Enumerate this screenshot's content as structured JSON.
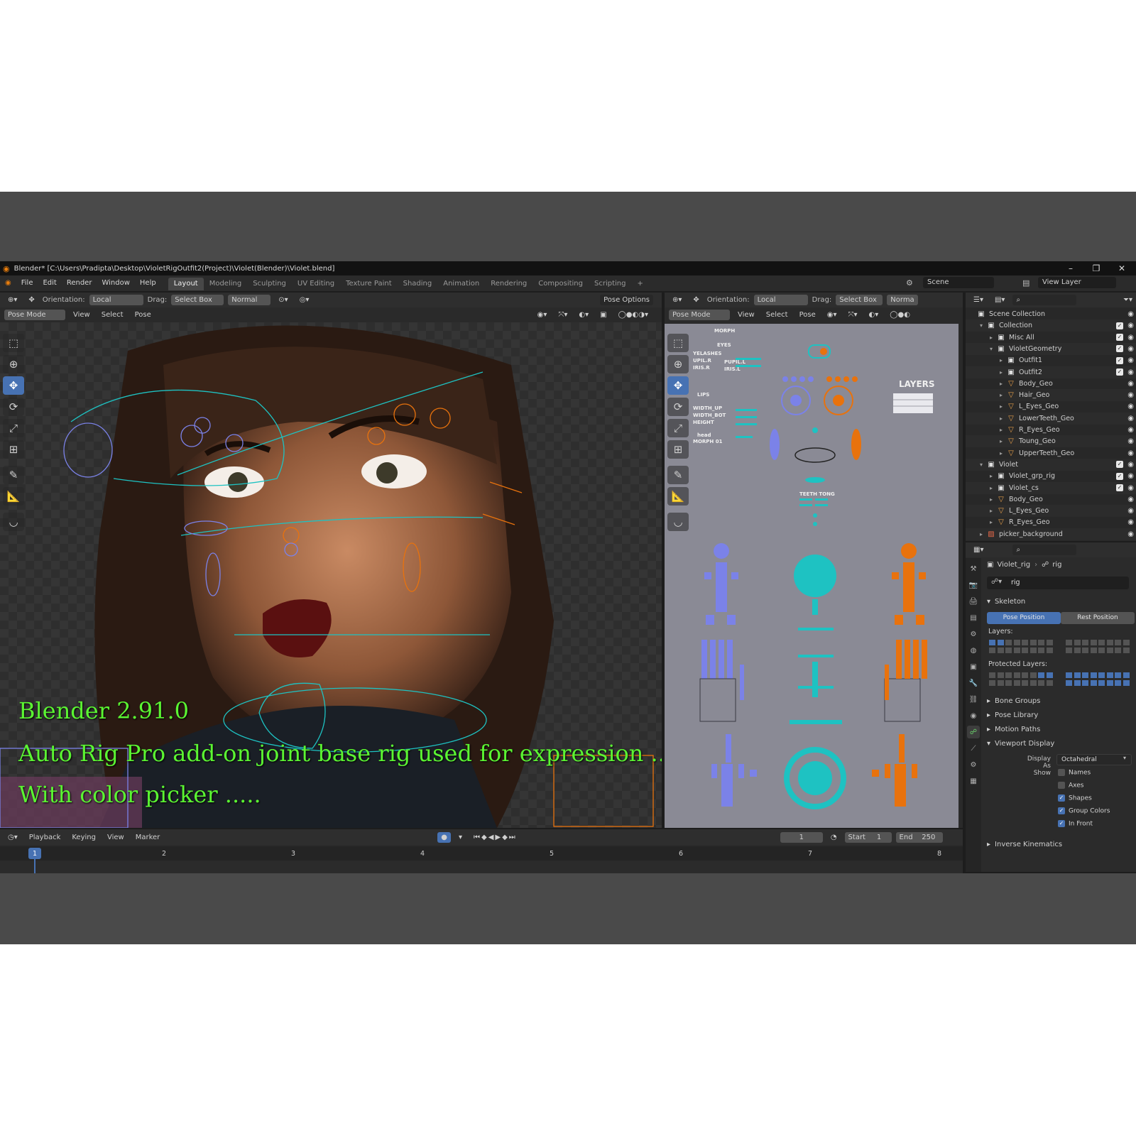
{
  "window": {
    "title": "Blender* [C:\\Users\\Pradipta\\Desktop\\VioletRigOutfit2(Project)\\Violet(Blender)\\Violet.blend]",
    "minimize": "–",
    "maximize": "❐",
    "close": "✕"
  },
  "menu": [
    "File",
    "Edit",
    "Render",
    "Window",
    "Help"
  ],
  "workspaces": [
    "Layout",
    "Modeling",
    "Sculpting",
    "UV Editing",
    "Texture Paint",
    "Shading",
    "Animation",
    "Rendering",
    "Compositing",
    "Scripting",
    "+"
  ],
  "scene": {
    "scene_name": "Scene",
    "view_layer": "View Layer"
  },
  "viewport": {
    "orientation_label": "Orientation:",
    "orientation_value": "Local",
    "drag_label": "Drag:",
    "drag_value": "Select Box",
    "pivot": "Normal",
    "pose_options": "Pose Options",
    "mode": "Pose Mode",
    "header_menus": [
      "View",
      "Select",
      "Pose"
    ],
    "overlay_lines": [
      "Blender 2.91.0",
      "Auto Rig Pro add-on joint base rig used for  expression ...",
      "With color picker ....."
    ]
  },
  "picker": {
    "orientation_label": "Orientation:",
    "orientation_value": "Local",
    "drag_label": "Drag:",
    "drag_value": "Select Box",
    "pivot": "Norma",
    "mode": "Pose Mode",
    "header_menus": [
      "View",
      "Select",
      "Pose"
    ],
    "labels": {
      "morph": "MORPH",
      "eyes": "EYES",
      "eyelashes": "YELASHES",
      "pupil_r": "UPIL.R",
      "iris_r": "IRIS.R",
      "pupil_l": "PUPIL.L",
      "iris_l": "IRIS.L",
      "lips": "LIPS",
      "width_up": "WIDTH_UP",
      "width_bot": "WIDTH_BOT",
      "height": "HEIGHT",
      "head": "head",
      "morph01": "MORPH 01",
      "teeth_tong": "TEETH  TONG",
      "layers": "LAYERS"
    }
  },
  "outliner": {
    "rows": [
      {
        "label": "Scene Collection",
        "depth": 0,
        "icon": "collection-icon",
        "tri": "",
        "check": false
      },
      {
        "label": "Collection",
        "depth": 1,
        "icon": "collection-icon",
        "tri": "▾",
        "check": true
      },
      {
        "label": "Misc All",
        "depth": 2,
        "icon": "collection-icon",
        "tri": "▸",
        "check": true
      },
      {
        "label": "VioletGeometry",
        "depth": 2,
        "icon": "collection-icon",
        "tri": "▾",
        "check": true
      },
      {
        "label": "Outfit1",
        "depth": 3,
        "icon": "collection-icon",
        "tri": "▸",
        "check": true
      },
      {
        "label": "Outfit2",
        "depth": 3,
        "icon": "collection-icon",
        "tri": "▸",
        "check": true
      },
      {
        "label": "Body_Geo",
        "depth": 3,
        "icon": "mesh-icon",
        "tri": "▸",
        "check": false
      },
      {
        "label": "Hair_Geo",
        "depth": 3,
        "icon": "mesh-icon",
        "tri": "▸",
        "check": false
      },
      {
        "label": "L_Eyes_Geo",
        "depth": 3,
        "icon": "mesh-icon",
        "tri": "▸",
        "check": false
      },
      {
        "label": "LowerTeeth_Geo",
        "depth": 3,
        "icon": "mesh-icon",
        "tri": "▸",
        "check": false
      },
      {
        "label": "R_Eyes_Geo",
        "depth": 3,
        "icon": "mesh-icon",
        "tri": "▸",
        "check": false
      },
      {
        "label": "Toung_Geo",
        "depth": 3,
        "icon": "mesh-icon",
        "tri": "▸",
        "check": false
      },
      {
        "label": "UpperTeeth_Geo",
        "depth": 3,
        "icon": "mesh-icon",
        "tri": "▸",
        "check": false
      },
      {
        "label": "Violet",
        "depth": 1,
        "icon": "collection-icon",
        "tri": "▾",
        "check": true
      },
      {
        "label": "Violet_grp_rig",
        "depth": 2,
        "icon": "collection-icon",
        "tri": "▸",
        "check": true
      },
      {
        "label": "Violet_cs",
        "depth": 2,
        "icon": "collection-icon",
        "tri": "▸",
        "check": true
      },
      {
        "label": "Body_Geo",
        "depth": 2,
        "icon": "mesh-icon",
        "tri": "▸",
        "check": false
      },
      {
        "label": "L_Eyes_Geo",
        "depth": 2,
        "icon": "mesh-icon",
        "tri": "▸",
        "check": false
      },
      {
        "label": "R_Eyes_Geo",
        "depth": 2,
        "icon": "mesh-icon",
        "tri": "▸",
        "check": false
      },
      {
        "label": "picker_background",
        "depth": 1,
        "icon": "image-icon",
        "tri": "▸",
        "check": false
      }
    ]
  },
  "properties": {
    "object_name": "Violet_rig",
    "data_name": "rig",
    "data_field": "rig",
    "skeleton": "Skeleton",
    "pose_position": "Pose Position",
    "rest_position": "Rest Position",
    "layers": "Layers:",
    "protected_layers": "Protected Layers:",
    "bone_groups": "Bone Groups",
    "pose_library": "Pose Library",
    "motion_paths": "Motion Paths",
    "viewport_display": "Viewport Display",
    "display_as_label": "Display As",
    "display_as_value": "Octahedral",
    "show_label": "Show",
    "names": "Names",
    "axes": "Axes",
    "shapes": "Shapes",
    "group_colors": "Group Colors",
    "in_front": "In Front",
    "inverse_kinematics": "Inverse Kinematics"
  },
  "timeline": {
    "menus": [
      "Playback",
      "Keying",
      "View",
      "Marker"
    ],
    "current_frame": "1",
    "start_label": "Start",
    "start_value": "1",
    "end_label": "End",
    "end_value": "250",
    "frame_marks": [
      "1",
      "2",
      "3",
      "4",
      "5",
      "6",
      "7",
      "8"
    ]
  },
  "colors": {
    "accent_blue": "#4772b3",
    "picker_blue": "#7b82e8",
    "picker_orange": "#e8720d",
    "picker_cyan": "#1ec2c2",
    "overlay_green": "#5bf532"
  }
}
